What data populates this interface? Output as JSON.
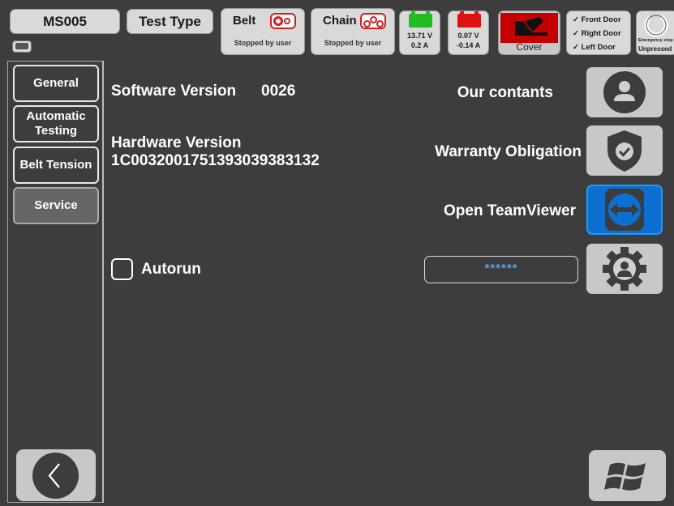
{
  "header": {
    "machine_id": "MS005",
    "test_type_label": "Test Type",
    "belt": {
      "title": "Belt",
      "status": "Stopped by user"
    },
    "chain": {
      "title": "Chain",
      "status": "Stopped by user"
    },
    "battery1": {
      "voltage": "13.71 V",
      "current": "0.2 A",
      "color": "#22bb22"
    },
    "battery2": {
      "voltage": "0.07 V",
      "current": "-0.14 A",
      "color": "#dd1111"
    },
    "cover": {
      "label": "Cover",
      "color": "#c40000"
    },
    "doors": [
      "✓ Front Door",
      "✓ Right Door",
      "✓ Left Door"
    ],
    "emergency": {
      "label": "Emergency stop",
      "state": "Unpressed"
    }
  },
  "nav": {
    "tabs": [
      {
        "label": "General"
      },
      {
        "label": "Automatic Testing"
      },
      {
        "label": "Belt Tension"
      },
      {
        "label": "Service"
      }
    ],
    "active_tab": "Service"
  },
  "main": {
    "software_label": "Software Version",
    "software_value": "0026",
    "hardware_label": "Hardware Version",
    "hardware_value": "1C0032001751393039383132",
    "contacts_label": "Our contants",
    "warranty_label": "Warranty Obligation",
    "teamviewer_label": "Open TeamViewer",
    "autorun_label": "Autorun",
    "autorun_checked": false,
    "password_value": "******"
  },
  "colors": {
    "background": "#3d3d3d",
    "button_gray": "#c8c8c8",
    "accent_blue": "#0d6fd0",
    "alert_red": "#d02020"
  },
  "icons": {
    "contacts": "user-circle-icon",
    "warranty": "shield-check-icon",
    "teamviewer": "teamviewer-icon",
    "settings": "user-gear-icon",
    "back": "chevron-left-icon",
    "windows": "windows-logo-icon"
  }
}
